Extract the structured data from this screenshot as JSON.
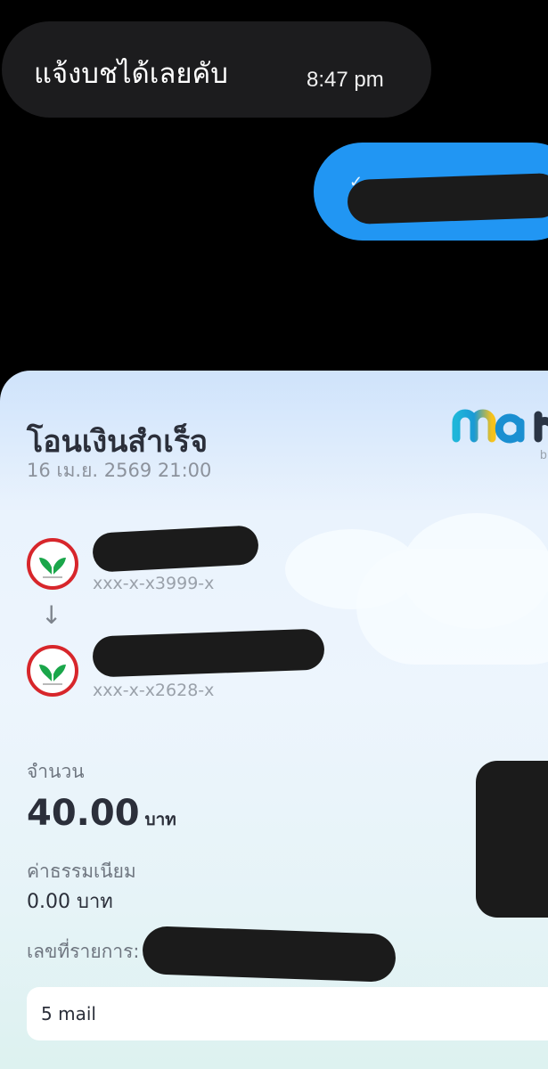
{
  "chat": {
    "incoming": {
      "text": "แจ้งบชได้เลยคับ",
      "time": "8:47 pm"
    },
    "outgoing": {
      "tick": "✓"
    }
  },
  "slip": {
    "title": "โอนเงินสำเร็จ",
    "datetime": "16 เม.ย. 2569 21:00",
    "brand_partial": "b",
    "from": {
      "account": "xxx-x-x3999-x"
    },
    "arrow": "↓",
    "to": {
      "account": "xxx-x-x2628-x"
    },
    "amount_label": "จำนวน",
    "amount": "40.00",
    "currency": "บาท",
    "fee_label": "ค่าธรรมเนียม",
    "fee": "0.00 บาท",
    "ref_label": "เลขที่รายการ:",
    "memo": "5 mail"
  },
  "colors": {
    "chat_bg": "#000000",
    "incoming_bubble": "#1c1c1e",
    "outgoing_bubble": "#2196f3",
    "bank_red": "#d7262b",
    "bank_green": "#1aa64a",
    "text_dark": "#2b2f3a"
  },
  "icons": {
    "bank_logo": "kasikorn-leaf-icon",
    "arrow": "arrow-down-icon"
  }
}
